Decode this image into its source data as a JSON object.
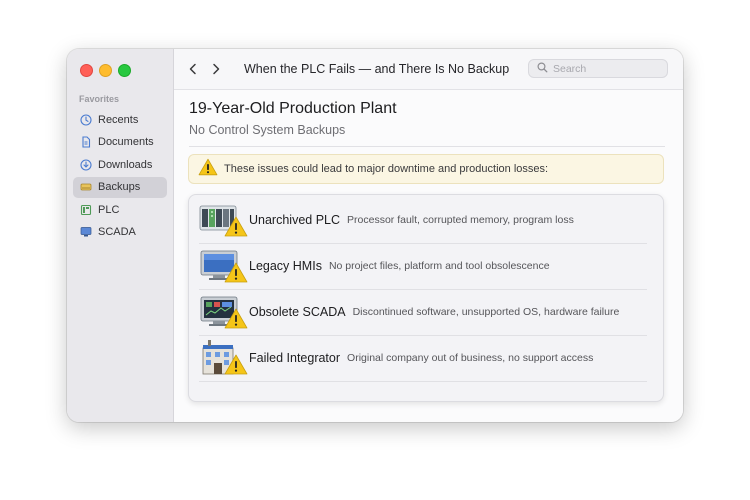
{
  "window": {
    "title": "When the PLC Fails — and There Is No Backup"
  },
  "search": {
    "placeholder": "Search"
  },
  "sidebar": {
    "section_label": "Favorites",
    "items": [
      {
        "label": "Recents",
        "icon": "clock-icon",
        "selected": false
      },
      {
        "label": "Documents",
        "icon": "document-icon",
        "selected": false
      },
      {
        "label": "Downloads",
        "icon": "download-icon",
        "selected": false
      },
      {
        "label": "Backups",
        "icon": "drive-icon",
        "selected": true
      },
      {
        "label": "PLC",
        "icon": "plc-icon",
        "selected": false
      },
      {
        "label": "SCADA",
        "icon": "monitor-icon",
        "selected": false
      }
    ]
  },
  "main": {
    "title": "19-Year-Old Production Plant",
    "subtitle": "No Control System Backups",
    "banner": "These issues could lead to major downtime and production losses:",
    "issues": [
      {
        "title": "Unarchived PLC",
        "description": "Processor fault, corrupted memory, program loss",
        "icon": "plc-rack-warning-icon"
      },
      {
        "title": "Legacy HMIs",
        "description": "No project files, platform and tool obsolescence",
        "icon": "hmi-monitor-warning-icon"
      },
      {
        "title": "Obsolete SCADA",
        "description": "Discontinued software, unsupported OS, hardware failure",
        "icon": "scada-screen-warning-icon"
      },
      {
        "title": "Failed Integrator",
        "description": "Original company out of business, no support access",
        "icon": "building-warning-icon"
      }
    ]
  },
  "colors": {
    "warning": "#f5c518",
    "banner_bg": "#fbf6e3",
    "selected": "#d2d1d7"
  }
}
